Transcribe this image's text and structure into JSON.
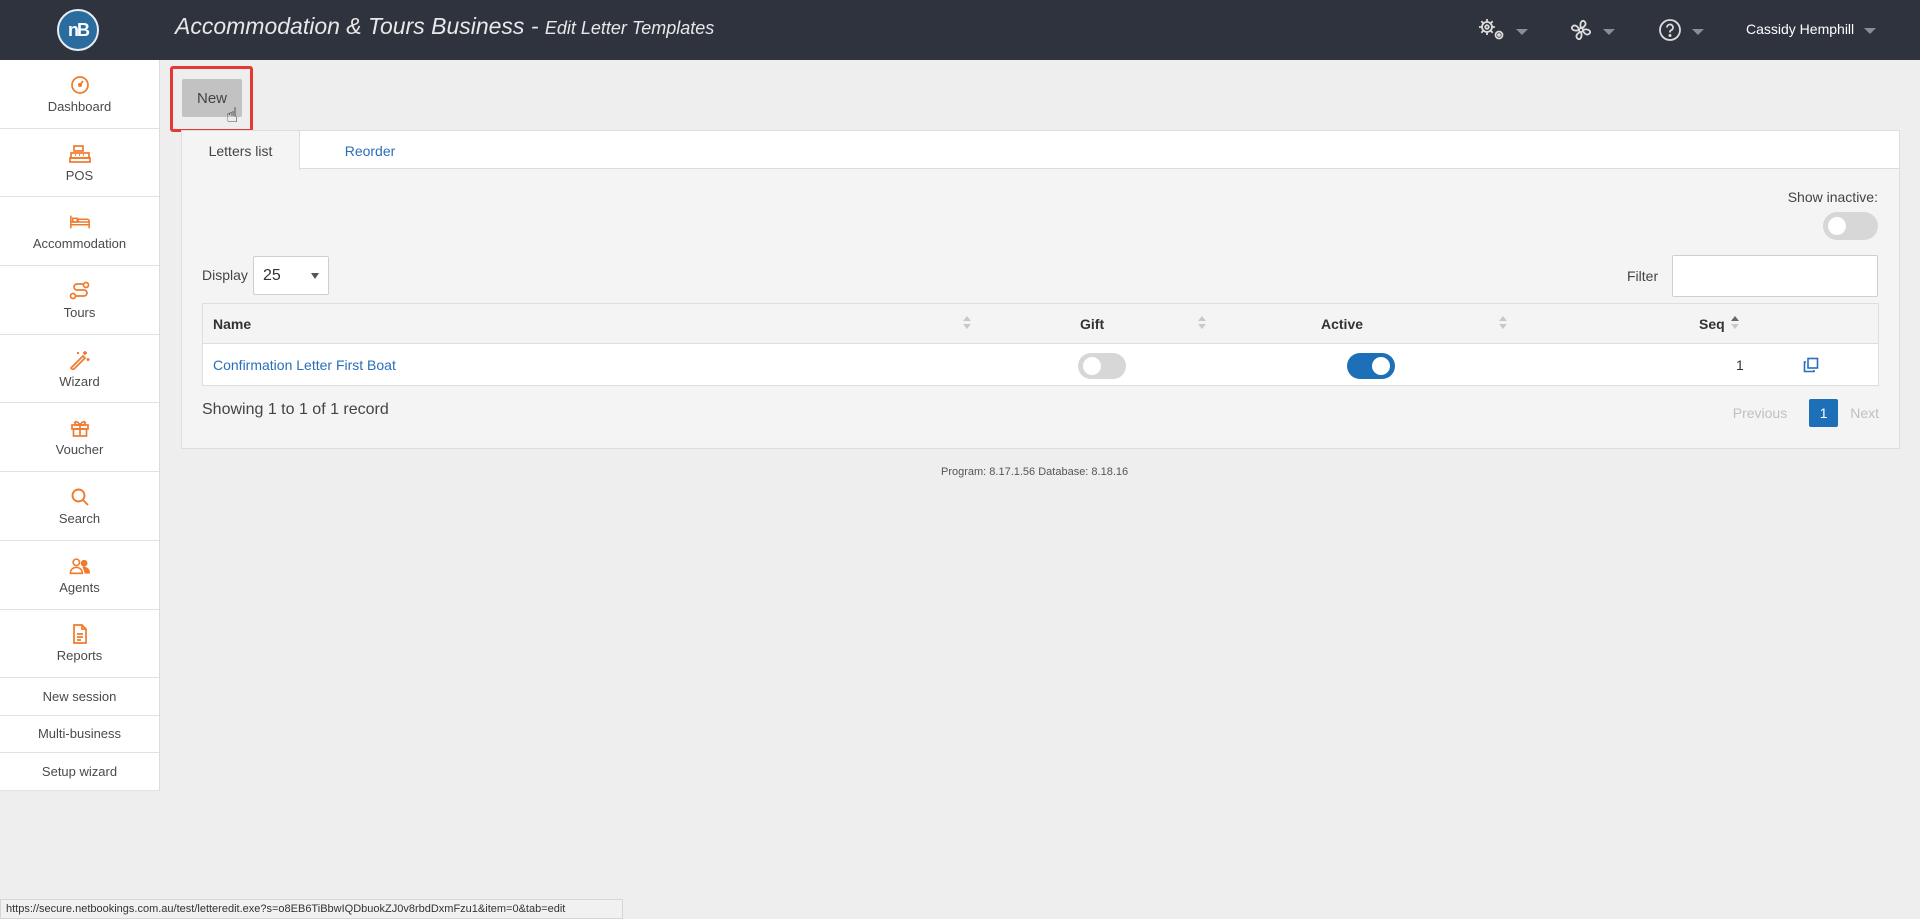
{
  "header": {
    "logo_text": "nB",
    "title": "Accommodation & Tours Business -",
    "subtitle": "Edit Letter Templates",
    "user_name": "Cassidy Hemphill",
    "icons": [
      "gears-icon",
      "fan-icon",
      "help-icon"
    ]
  },
  "sidebar": {
    "items": [
      {
        "label": "Dashboard",
        "icon": "dashboard-icon"
      },
      {
        "label": "POS",
        "icon": "cash-register-icon"
      },
      {
        "label": "Accommodation",
        "icon": "bed-icon"
      },
      {
        "label": "Tours",
        "icon": "route-icon"
      },
      {
        "label": "Wizard",
        "icon": "magic-wand-icon"
      },
      {
        "label": "Voucher",
        "icon": "gift-icon"
      },
      {
        "label": "Search",
        "icon": "search-icon"
      },
      {
        "label": "Agents",
        "icon": "users-icon"
      },
      {
        "label": "Reports",
        "icon": "report-icon"
      }
    ],
    "links": [
      {
        "label": "New session"
      },
      {
        "label": "Multi-business"
      },
      {
        "label": "Setup wizard"
      }
    ]
  },
  "toolbar": {
    "new_label": "New"
  },
  "tabs": [
    {
      "label": "Letters list",
      "active": true
    },
    {
      "label": "Reorder",
      "active": false
    }
  ],
  "controls": {
    "show_inactive_label": "Show inactive:",
    "show_inactive_on": false,
    "display_label": "Display",
    "display_value": "25",
    "filter_label": "Filter",
    "filter_value": ""
  },
  "table": {
    "columns": [
      "Name",
      "Gift",
      "Active",
      "Seq"
    ],
    "rows": [
      {
        "name": "Confirmation Letter First Boat",
        "gift": false,
        "active": true,
        "seq": "1"
      }
    ]
  },
  "footer": {
    "showing": "Showing 1 to 1 of 1 record",
    "previous": "Previous",
    "page": "1",
    "next": "Next",
    "version": "Program: 8.17.1.56 Database: 8.18.16"
  },
  "statusbar": {
    "url": "https://secure.netbookings.com.au/test/letteredit.exe?s=o8EB6TiBbwIQDbuokZJ0v8rbdDxmFzu1&item=0&tab=edit"
  },
  "colors": {
    "header_bg": "#2f333e",
    "accent_orange": "#f07a2c",
    "link_blue": "#2a6ebb",
    "toggle_on": "#1d6fb8",
    "highlight_red": "#e53935"
  }
}
